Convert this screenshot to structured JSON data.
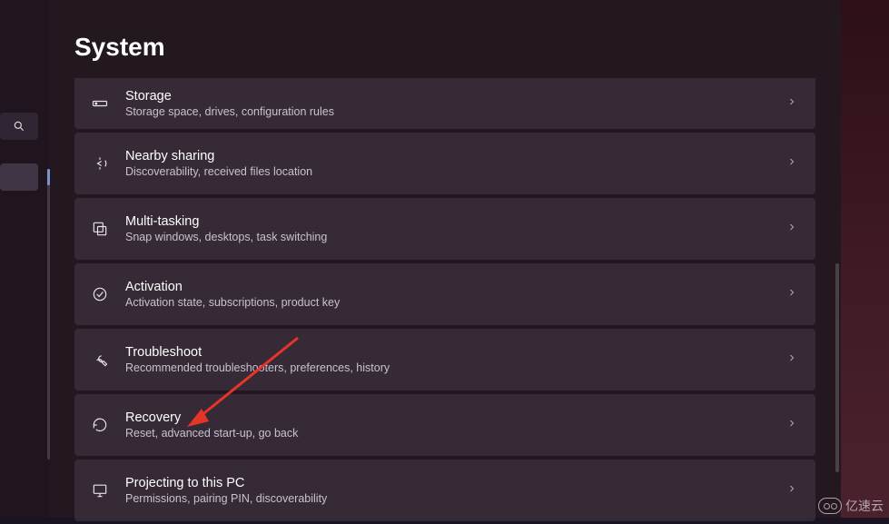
{
  "page": {
    "title": "System"
  },
  "items": [
    {
      "key": "storage",
      "title": "Storage",
      "sub": "Storage space, drives, configuration rules"
    },
    {
      "key": "nearby",
      "title": "Nearby sharing",
      "sub": "Discoverability, received files location"
    },
    {
      "key": "multitask",
      "title": "Multi-tasking",
      "sub": "Snap windows, desktops, task switching"
    },
    {
      "key": "activation",
      "title": "Activation",
      "sub": "Activation state, subscriptions, product key"
    },
    {
      "key": "troubleshoot",
      "title": "Troubleshoot",
      "sub": "Recommended troubleshooters, preferences, history"
    },
    {
      "key": "recovery",
      "title": "Recovery",
      "sub": "Reset, advanced start-up, go back"
    },
    {
      "key": "projecting",
      "title": "Projecting to this PC",
      "sub": "Permissions, pairing PIN, discoverability"
    }
  ],
  "watermark": "亿速云",
  "annotation": {
    "arrow_color": "#e53528"
  }
}
